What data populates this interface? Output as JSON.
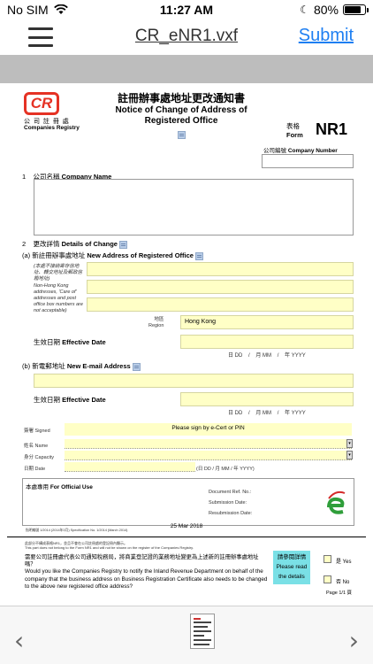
{
  "status": {
    "carrier": "No SIM",
    "time": "11:27 AM",
    "battery": "80%",
    "battery_level": 0.8
  },
  "nav": {
    "title": "CR_eNR1.vxf",
    "submit": "Submit"
  },
  "form": {
    "logo_text": "CR",
    "registry_zh": "公 司 註 冊 處",
    "registry_en": "Companies Registry",
    "title_zh": "註冊辦事處地址更改通知書",
    "title_en_1": "Notice of Change of Address of",
    "title_en_2": "Registered Office",
    "form_label_zh": "表格",
    "form_label_en": "Form",
    "form_no": "NR1",
    "company_no_zh": "公司編號",
    "company_no_en": "Company Number",
    "s1_no": "1",
    "s1_zh": "公司名稱",
    "s1_en": "Company Name",
    "s2_no": "2",
    "s2_zh": "更改詳情",
    "s2_en": "Details of Change",
    "a_prefix": "(a)",
    "a_zh": "新註冊辦事處地址",
    "a_en": "New Address of Registered Office",
    "a_note_zh": "(本處不接納寄存信地址、轉交地址及郵政信箱地址)",
    "a_note_en": "Non-Hong Kong addresses, 'Care of' addresses and post office box numbers are not acceptable)",
    "region_zh": "地區",
    "region_en": "Region",
    "region_value": "Hong Kong",
    "eff_zh": "生效日期",
    "eff_en": "Effective Date",
    "date_dd": "日 DD",
    "date_mm": "月 MM",
    "date_yyyy": "年 YYYY",
    "b_prefix": "(b)",
    "b_zh": "新電郵地址",
    "b_en": "New E-mail Address",
    "signed_zh": "簽署",
    "signed_en": "Signed",
    "sign_hint": "Please sign by e-Cert or PIN",
    "name_zh": "姓名",
    "name_en": "Name",
    "capacity_zh": "身分",
    "capacity_en": "Capacity",
    "date_zh": "日期",
    "date_en": "Date",
    "date_format": "(日 DD / 月 MM / 年 YYYY)",
    "official_zh": "本處專用",
    "official_en": "For Official Use",
    "doc_ref": "Document Ref. No.:",
    "submission_date": "Submission Date:",
    "resubmission_date": "Resubmission Date:",
    "spec_line": "指明編號 1/2014 (2014年3月) Specification No. 1/2014 (March 2014)",
    "print_date": "25 Mar 2018",
    "bottom_note_zh": "此部分不構成表格NR1，並且不會在公司註冊處的登記冊內顯示。",
    "bottom_note_en": "This part does not belong to the Form NR1 and will not be shown on the register of the Companies Registry.",
    "question_zh": "需要公司註冊處代表公司通知稅務局，將商業登記證的業務地址變更為上述新的註冊辦事處地址嗎？",
    "question_en": "Would you like the Companies Registry to notify the Inland Revenue Department on behalf of the company that the business address on Business Registration Certificate also needs to be changed to the above new registered office address?",
    "details_btn": [
      "請參閱詳情",
      "Please read",
      "the details"
    ],
    "yes": "是 Yes",
    "no": "否 No",
    "page": "Page 1/1 頁"
  },
  "toolbar": {
    "prev": "‹",
    "next": "›"
  }
}
